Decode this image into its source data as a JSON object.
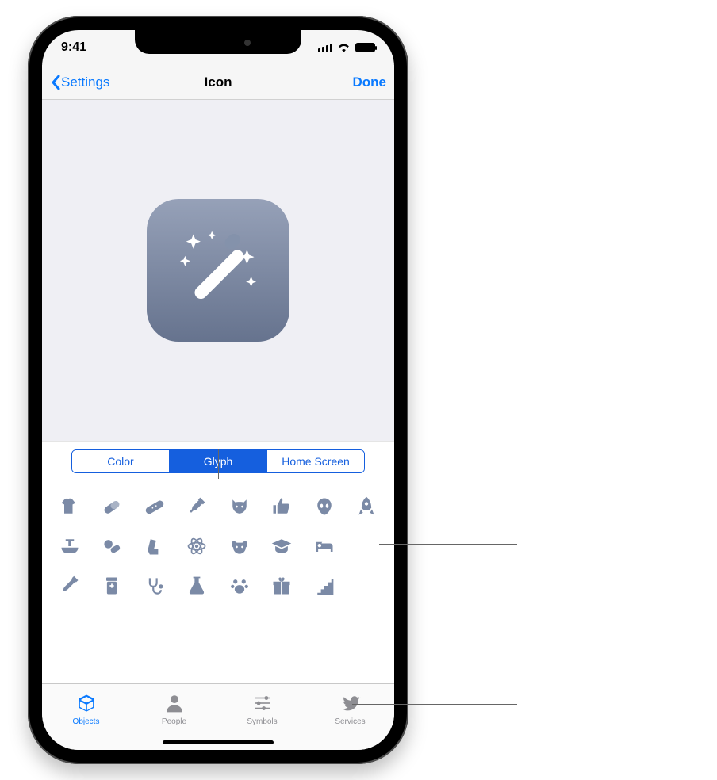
{
  "status": {
    "time": "9:41"
  },
  "nav": {
    "back": "Settings",
    "title": "Icon",
    "done": "Done"
  },
  "segments": [
    "Color",
    "Glyph",
    "Home Screen"
  ],
  "segment_active_index": 1,
  "glyph_tint": "#7b8aa6",
  "glyphs": [
    "shirt",
    "pill",
    "bandage",
    "syringe",
    "cat-face",
    "thumbs-up",
    "alien",
    "rocket",
    "sink",
    "pills",
    "inhaler",
    "atom",
    "dog-face",
    "graduation-cap",
    "bed",
    "blank",
    "dropper",
    "pill-bottle",
    "stethoscope",
    "flask",
    "paw",
    "gift",
    "stairs",
    "blank"
  ],
  "tabs": [
    {
      "label": "Objects",
      "icon": "cube",
      "active": true
    },
    {
      "label": "People",
      "icon": "person",
      "active": false
    },
    {
      "label": "Symbols",
      "icon": "sliders",
      "active": false
    },
    {
      "label": "Services",
      "icon": "bird",
      "active": false
    }
  ]
}
